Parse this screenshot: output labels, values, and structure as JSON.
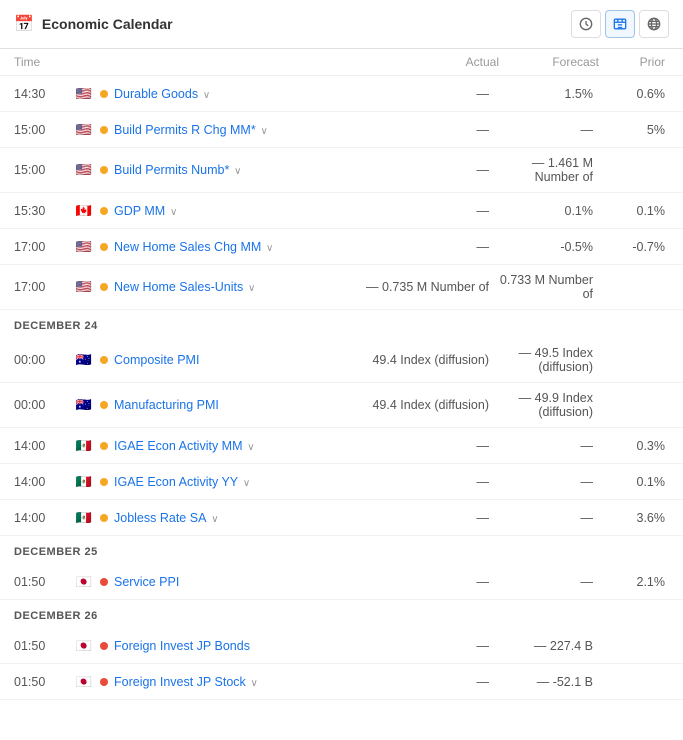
{
  "header": {
    "title": "Economic Calendar",
    "icon_calendar": "📅",
    "icons": [
      {
        "name": "clock-icon",
        "symbol": "⏱",
        "active": false
      },
      {
        "name": "chart-icon",
        "symbol": "📊",
        "active": true
      },
      {
        "name": "globe-icon",
        "symbol": "🌐",
        "active": false
      }
    ]
  },
  "columns": {
    "time": "Time",
    "actual": "Actual",
    "forecast": "Forecast",
    "prior": "Prior"
  },
  "sections": [
    {
      "date": null,
      "events": [
        {
          "time": "14:30",
          "flag": "🇺🇸",
          "flag_type": "us",
          "dot": "orange",
          "name": "Durable Goods",
          "chevron": true,
          "actual": "—",
          "forecast": "1.5%",
          "prior": "0.6%"
        },
        {
          "time": "15:00",
          "flag": "🇺🇸",
          "flag_type": "us",
          "dot": "orange",
          "name": "Build Permits R Chg MM*",
          "chevron": true,
          "actual": "—",
          "forecast": "—",
          "prior": "5%"
        },
        {
          "time": "15:00",
          "flag": "🇺🇸",
          "flag_type": "us",
          "dot": "orange",
          "name": "Build Permits Numb*",
          "chevron": true,
          "actual": "—",
          "forecast": "— 1.461 M Number of",
          "prior": ""
        },
        {
          "time": "15:30",
          "flag": "🇨🇦",
          "flag_type": "ca",
          "dot": "orange",
          "name": "GDP MM",
          "chevron": true,
          "actual": "—",
          "forecast": "0.1%",
          "prior": "0.1%"
        },
        {
          "time": "17:00",
          "flag": "🇺🇸",
          "flag_type": "us",
          "dot": "orange",
          "name": "New Home Sales Chg MM",
          "chevron": true,
          "actual": "—",
          "forecast": "-0.5%",
          "prior": "-0.7%"
        },
        {
          "time": "17:00",
          "flag": "🇺🇸",
          "flag_type": "us",
          "dot": "orange",
          "name": "New Home Sales-Units",
          "chevron": true,
          "actual": "— 0.735 M Number of",
          "forecast": "0.733 M Number of",
          "prior": ""
        }
      ]
    },
    {
      "date": "DECEMBER 24",
      "events": [
        {
          "time": "00:00",
          "flag": "🇦🇺",
          "flag_type": "au",
          "dot": "orange",
          "name": "Composite PMI",
          "chevron": false,
          "actual": "49.4 Index (diffusion)",
          "forecast": "— 49.5 Index (diffusion)",
          "prior": ""
        },
        {
          "time": "00:00",
          "flag": "🇦🇺",
          "flag_type": "au",
          "dot": "orange",
          "name": "Manufacturing PMI",
          "chevron": false,
          "actual": "49.4 Index (diffusion)",
          "forecast": "— 49.9 Index (diffusion)",
          "prior": ""
        },
        {
          "time": "14:00",
          "flag": "🇲🇽",
          "flag_type": "mx",
          "dot": "orange",
          "name": "IGAE Econ Activity MM",
          "chevron": true,
          "actual": "—",
          "forecast": "—",
          "prior": "0.3%"
        },
        {
          "time": "14:00",
          "flag": "🇲🇽",
          "flag_type": "mx",
          "dot": "orange",
          "name": "IGAE Econ Activity YY",
          "chevron": true,
          "actual": "—",
          "forecast": "—",
          "prior": "0.1%"
        },
        {
          "time": "14:00",
          "flag": "🇲🇽",
          "flag_type": "mx",
          "dot": "orange",
          "name": "Jobless Rate SA",
          "chevron": true,
          "actual": "—",
          "forecast": "—",
          "prior": "3.6%"
        }
      ]
    },
    {
      "date": "DECEMBER 25",
      "events": [
        {
          "time": "01:50",
          "flag": "🇯🇵",
          "flag_type": "jp",
          "dot": "red",
          "name": "Service PPI",
          "chevron": false,
          "actual": "—",
          "forecast": "—",
          "prior": "2.1%"
        }
      ]
    },
    {
      "date": "DECEMBER 26",
      "events": [
        {
          "time": "01:50",
          "flag": "🇯🇵",
          "flag_type": "jp",
          "dot": "red",
          "name": "Foreign Invest JP Bonds",
          "chevron": false,
          "actual": "—",
          "forecast": "— 227.4 B",
          "prior": ""
        },
        {
          "time": "01:50",
          "flag": "🇯🇵",
          "flag_type": "jp",
          "dot": "red",
          "name": "Foreign Invest JP Stock",
          "chevron": true,
          "actual": "—",
          "forecast": "— -52.1 B",
          "prior": ""
        }
      ]
    }
  ]
}
